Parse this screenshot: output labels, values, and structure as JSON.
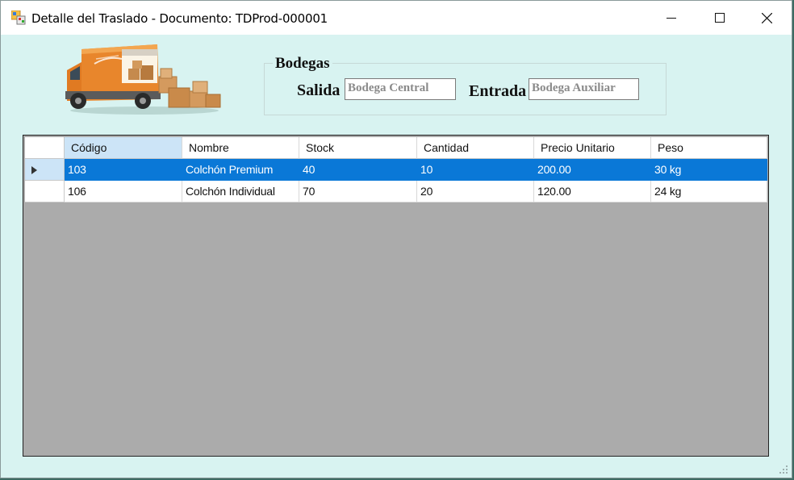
{
  "window": {
    "title": "Detalle del Traslado - Documento: TDProd-000001",
    "minimize_icon": "minimize-icon",
    "maximize_icon": "maximize-icon",
    "close_icon": "close-icon"
  },
  "bodegas": {
    "group_title": "Bodegas",
    "salida_label": "Salida",
    "salida_value": "Bodega Central",
    "entrada_label": "Entrada",
    "entrada_value": "Bodega Auxiliar"
  },
  "grid": {
    "columns": [
      "Código",
      "Nombre",
      "Stock",
      "Cantidad",
      "Precio Unitario",
      "Peso"
    ],
    "rows": [
      [
        "103",
        "Colchón Premium",
        "40",
        "10",
        "200.00",
        "30 kg"
      ],
      [
        "106",
        "Colchón Individual",
        "70",
        "20",
        "120.00",
        "24 kg"
      ]
    ],
    "selected_row": 0,
    "selected_column_header": 0,
    "current_row_icon": "row-pointer-icon"
  },
  "colors": {
    "background": "#d8f3f1",
    "selection": "#0a78d7",
    "header_selected": "#cce4f7",
    "grid_empty": "#ababab"
  }
}
